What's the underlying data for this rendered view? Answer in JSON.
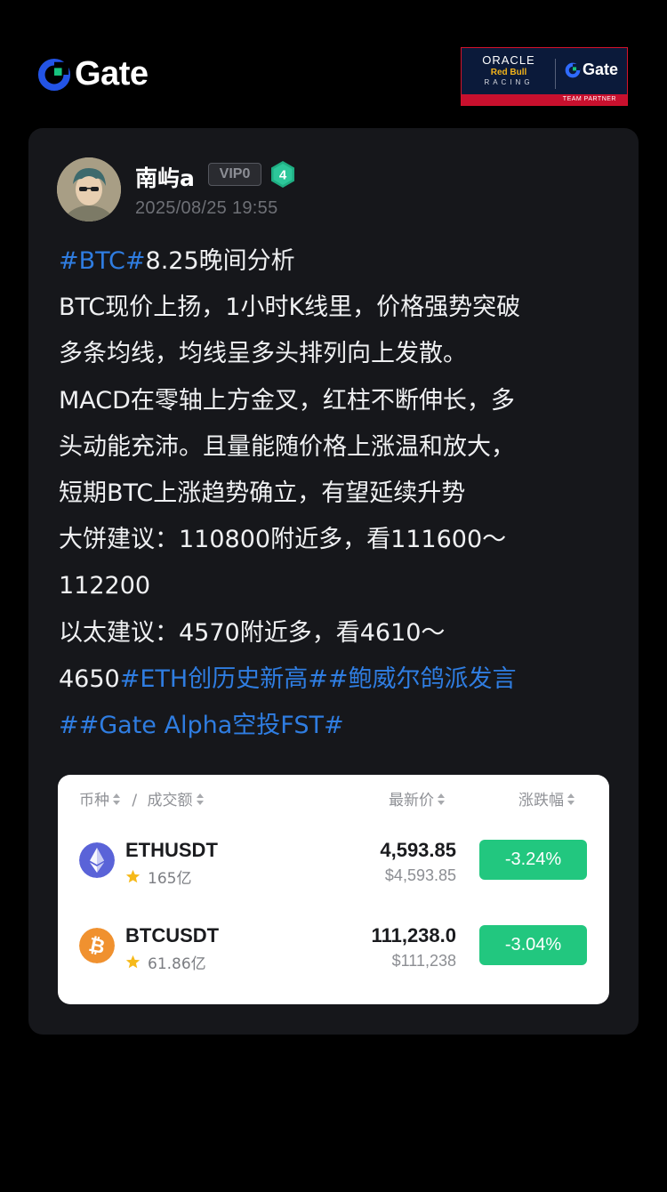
{
  "header": {
    "brand": "Gate",
    "partner": {
      "oracle": "ORACLE",
      "redbull": "Red Bull",
      "racing": "RACING",
      "gate": "Gate",
      "team": "TEAM PARTNER"
    }
  },
  "post": {
    "username": "南屿a",
    "vip_badge": "VIP0",
    "level": "4",
    "timestamp": "2025/08/25 19:55",
    "lines": [
      [
        {
          "t": "#BTC#",
          "tag": true
        },
        {
          "t": "8.25晚间分析"
        }
      ],
      [
        {
          "t": "BTC现价上扬，1小时K线里，价格强势突破"
        }
      ],
      [
        {
          "t": "多条均线，均线呈多头排列向上发散。"
        }
      ],
      [
        {
          "t": "MACD在零轴上方金叉，红柱不断伸长，多"
        }
      ],
      [
        {
          "t": "头动能充沛。且量能随价格上涨温和放大，"
        }
      ],
      [
        {
          "t": "短期BTC上涨趋势确立，有望延续升势"
        }
      ],
      [
        {
          "t": "大饼建议：110800附近多，看111600～"
        }
      ],
      [
        {
          "t": "112200"
        }
      ],
      [
        {
          "t": "以太建议：4570附近多，看4610～"
        }
      ],
      [
        {
          "t": "4650"
        },
        {
          "t": "#ETH创历史新高#",
          "tag": true
        },
        {
          "t": "#鲍威尔鸽派发言",
          "tag": true
        }
      ],
      [
        {
          "t": "#",
          "tag": true
        },
        {
          "t": "#Gate Alpha空投FST#",
          "tag": true
        }
      ]
    ]
  },
  "market": {
    "headers": {
      "coin": "币种",
      "slash": "/",
      "volume": "成交额",
      "last_price": "最新价",
      "change": "涨跌幅"
    },
    "rows": [
      {
        "pair": "ETHUSDT",
        "volume": "165亿",
        "price": "4,593.85",
        "fiat": "$4,593.85",
        "change": "-3.24%",
        "icon": "ethereum-icon"
      },
      {
        "pair": "BTCUSDT",
        "volume": "61.86亿",
        "price": "111,238.0",
        "fiat": "$111,238",
        "change": "-3.04%",
        "icon": "bitcoin-icon"
      }
    ]
  },
  "colors": {
    "tag": "#2f7de1",
    "brand_blue": "#2354e6",
    "change_bg": "#22c77f",
    "card_bg": "#16171b"
  }
}
